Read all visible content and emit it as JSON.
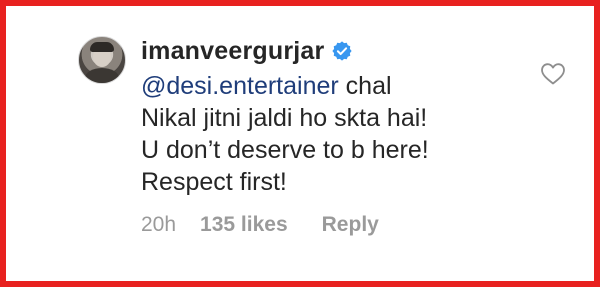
{
  "comment": {
    "username": "imanveergurjar",
    "verified": true,
    "mention": "@desi.entertainer",
    "lines": [
      " chal",
      "Nikal jitni jaldi ho skta hai!",
      "U don’t deserve to b here!",
      "Respect first!"
    ],
    "time_ago": "20h",
    "likes": "135 likes",
    "reply_label": "Reply"
  },
  "icons": {
    "verified": "verified-badge-icon",
    "like": "heart-outline-icon"
  },
  "colors": {
    "frame_border": "#e8211f",
    "text": "#262626",
    "mention": "#1f3d7a",
    "verified_blue": "#3897f0",
    "meta_gray": "#9a9a9a"
  }
}
